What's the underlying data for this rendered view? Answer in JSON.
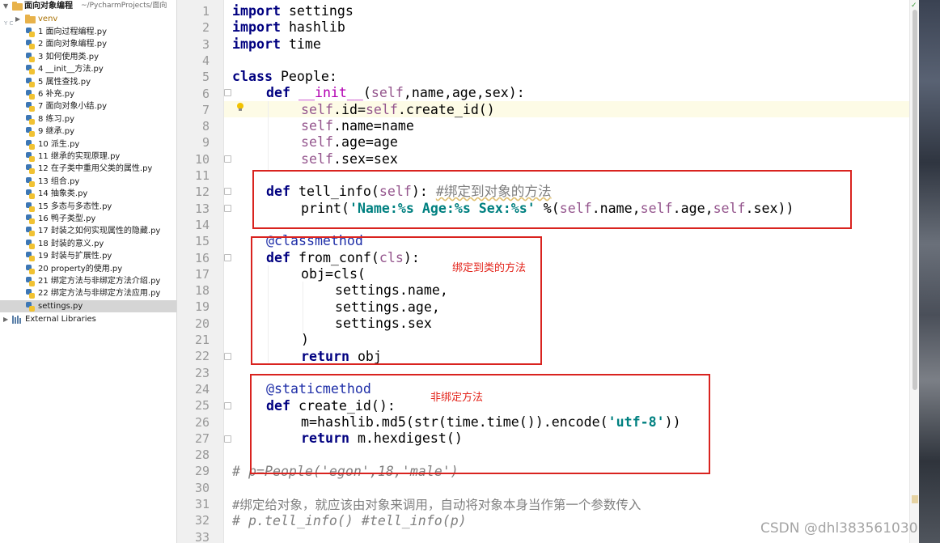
{
  "project": {
    "name": "面向对象编程",
    "path": "~/PycharmProjects/面向",
    "venv": "venv",
    "files": [
      "1 面向过程编程.py",
      "2 面向对象编程.py",
      "3 如何使用类.py",
      "4 __init__方法.py",
      "5 属性查找.py",
      "6 补充.py",
      "7 面向对象小结.py",
      "8 练习.py",
      "9 继承.py",
      "10 派生.py",
      "11 继承的实现原理.py",
      "12 在子类中重用父类的属性.py",
      "13 组合.py",
      "14 抽象类.py",
      "15 多态与多态性.py",
      "16 鸭子类型.py",
      "17 封装之如何实现属性的隐藏.py",
      "18 封装的意义.py",
      "19 封装与扩展性.py",
      "20 property的使用.py",
      "21 绑定方法与非绑定方法介绍.py",
      "22 绑定方法与非绑定方法应用.py",
      "settings.py"
    ],
    "selected_file": "settings.py",
    "external": "External Libraries"
  },
  "editor": {
    "line_numbers": [
      "1",
      "2",
      "3",
      "4",
      "5",
      "6",
      "7",
      "8",
      "9",
      "10",
      "11",
      "12",
      "13",
      "14",
      "15",
      "16",
      "17",
      "18",
      "19",
      "20",
      "21",
      "22",
      "23",
      "24",
      "25",
      "26",
      "27",
      "28",
      "29",
      "30",
      "31",
      "32",
      "33"
    ],
    "code": {
      "l1_kw": "import",
      "l1_rest": " settings",
      "l2_kw": "import",
      "l2_rest": " hashlib",
      "l3_kw": "import",
      "l3_rest": " time",
      "l5_kw": "class",
      "l5_rest": " People:",
      "l6_kw": "def",
      "l6_fn": " __init__",
      "l6_p1": "(",
      "l6_self": "self",
      "l6_rest": ",name,age,sex):",
      "l7_s1": "self",
      "l7_m": ".id=",
      "l7_s2": "self",
      "l7_e": ".create_id()",
      "l8_s": "self",
      "l8_e": ".name=name",
      "l9_s": "self",
      "l9_e": ".age=age",
      "l10_s": "self",
      "l10_e": ".sex=sex",
      "l12_kw": "def",
      "l12_fn": " tell_info(",
      "l12_self": "self",
      "l12_close": "): ",
      "l12_cmt": "#绑定到对象的方法",
      "l13_fn": "print(",
      "l13_str": "'Name:%s Age:%s Sex:%s'",
      "l13_mid": " %(",
      "l13_s1": "self",
      "l13_a1": ".name,",
      "l13_s2": "self",
      "l13_a2": ".age,",
      "l13_s3": "self",
      "l13_a3": ".sex))",
      "l15_deco": "@classmethod",
      "l16_kw": "def",
      "l16_fn": " from_conf(",
      "l16_cls": "cls",
      "l16_close": "):",
      "l17": "obj=cls(",
      "l18": "settings.name,",
      "l19": "settings.age,",
      "l20": "settings.sex",
      "l21": ")",
      "l22_kw": "return",
      "l22_rest": " obj",
      "l24_deco": "@staticmethod",
      "l25_kw": "def",
      "l25_fn": " create_id():",
      "l26_a": "m=hashlib.md5(str(time.time()).encode(",
      "l26_str": "'utf-8'",
      "l26_b": "))",
      "l27_kw": "return",
      "l27_rest": " m.hexdigest()",
      "l29": "# p=People('egon',18,'male')",
      "l31": "#绑定给对象，就应该由对象来调用，自动将对象本身当作第一个参数传入",
      "l32": "# p.tell_info() #tell_info(p)"
    },
    "annotations": {
      "class_method": "绑定到类的方法",
      "static_method": "非绑定方法"
    },
    "colors": {
      "annotation_red": "#d9231f",
      "keyword": "#000080",
      "self": "#94558d",
      "string": "#008080",
      "comment": "#808080"
    }
  },
  "watermark": "CSDN @dhl383561030"
}
